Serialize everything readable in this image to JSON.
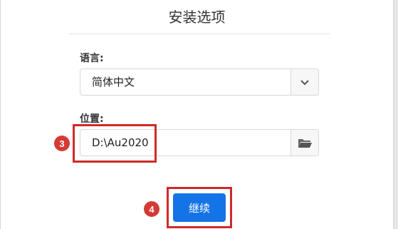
{
  "dialog": {
    "title": "安装选项"
  },
  "language": {
    "label": "语言:",
    "value": "简体中文",
    "dropdown_icon": "chevron-down-icon"
  },
  "location": {
    "label": "位置:",
    "value": "D:\\Au2020",
    "browse_icon": "folder-icon"
  },
  "steps": {
    "step3": "3",
    "step4": "4"
  },
  "actions": {
    "continue_label": "继续"
  },
  "colors": {
    "accent": "#1473e6",
    "annotation_red": "#cf2a2a",
    "step_badge": "#d43a36"
  }
}
